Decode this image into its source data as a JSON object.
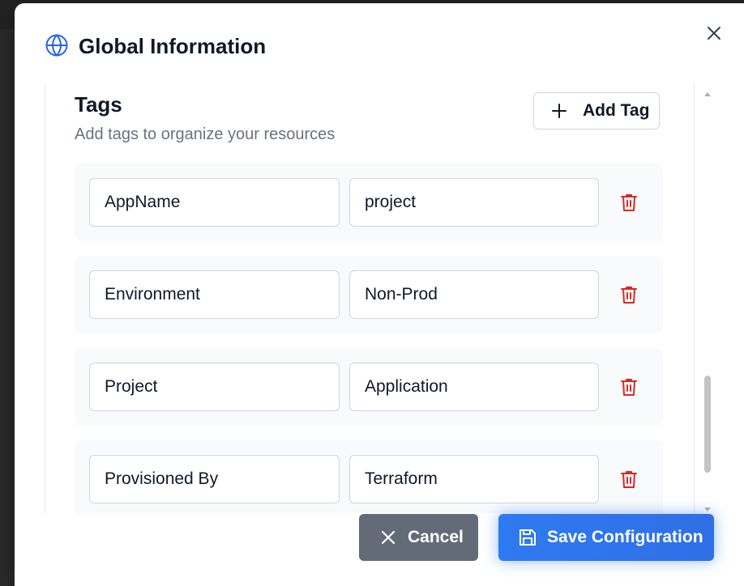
{
  "dialog": {
    "title": "Global Information",
    "icon": "globe-icon",
    "accent_color": "#2563eb"
  },
  "tags_section": {
    "title": "Tags",
    "subtitle": "Add tags to organize your resources",
    "add_button_label": "Add Tag"
  },
  "tags": [
    {
      "key": "AppName",
      "value": "project"
    },
    {
      "key": "Environment",
      "value": "Non-Prod"
    },
    {
      "key": "Project",
      "value": "Application"
    },
    {
      "key": "Provisioned By",
      "value": "Terraform"
    }
  ],
  "footer": {
    "cancel_label": "Cancel",
    "save_label": "Save Configuration"
  },
  "colors": {
    "delete": "#dc2626",
    "cancel_bg": "#646b78",
    "save_bg": "#2f74ec"
  }
}
